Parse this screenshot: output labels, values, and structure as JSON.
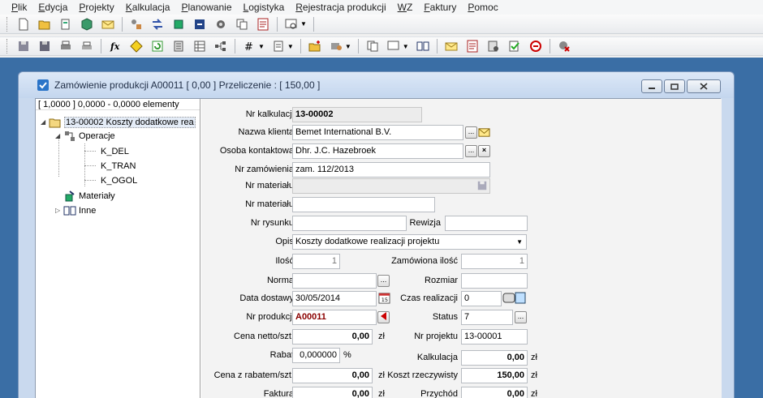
{
  "menu": [
    "Plik",
    "Edycja",
    "Projekty",
    "Kalkulacja",
    "Planowanie",
    "Logistyka",
    "Rejestracja produkcji",
    "WZ",
    "Faktury",
    "Pomoc"
  ],
  "window": {
    "title": "Zamówienie produkcji A00011 [ 0,00 ] Przeliczenie : [ 150,00 ]"
  },
  "tree": {
    "header": "[ 1,0000 ] 0,0000 - 0,0000 elementy",
    "root": "13-00002 Koszty dodatkowe rea",
    "operacje": "Operacje",
    "ops": [
      "K_DEL",
      "K_TRAN",
      "K_OGOL"
    ],
    "materialy": "Materiały",
    "inne": "Inne"
  },
  "form": {
    "nr_kalkulacji": {
      "label": "Nr kalkulacji",
      "value": "13-00002"
    },
    "nazwa_klienta": {
      "label": "Nazwa klienta",
      "value": "Bemet International B.V."
    },
    "osoba_kontaktowa": {
      "label": "Osoba kontaktowa",
      "value": "Dhr. J.C. Hazebroek"
    },
    "nr_zamowienia": {
      "label": "Nr zamówienia",
      "value": "zam. 112/2013"
    },
    "nr_materialu1": {
      "label": "Nr materiału",
      "value": ""
    },
    "nr_materialu2": {
      "label": "Nr materiału",
      "value": ""
    },
    "nr_rysunku": {
      "label": "Nr rysunku",
      "value": ""
    },
    "rewizja": {
      "label": "Rewizja",
      "value": ""
    },
    "opis": {
      "label": "Opis",
      "value": "Koszty dodatkowe realizacji projektu"
    },
    "ilosc": {
      "label": "Ilość",
      "value": "1"
    },
    "zamowiona_ilosc": {
      "label": "Zamówiona ilość",
      "value": "1"
    },
    "norma": {
      "label": "Norma",
      "value": ""
    },
    "rozmiar": {
      "label": "Rozmiar",
      "value": ""
    },
    "data_dostawy": {
      "label": "Data dostawy",
      "value": "30/05/2014"
    },
    "czas_realizacji": {
      "label": "Czas realizacji",
      "value": "0"
    },
    "nr_produkcji": {
      "label": "Nr produkcji",
      "value": "A00011"
    },
    "status": {
      "label": "Status",
      "value": "7"
    },
    "cena_netto": {
      "label": "Cena netto/szt.",
      "value": "0,00",
      "unit": "zł"
    },
    "nr_projektu": {
      "label": "Nr projektu",
      "value": "13-00001"
    },
    "rabat": {
      "label": "Rabat",
      "value": "0,000000",
      "unit": "%"
    },
    "kalkulacja": {
      "label": "Kalkulacja",
      "value": "0,00",
      "unit": "zł"
    },
    "cena_z_rabatem": {
      "label": "Cena z rabatem/szt.",
      "value": "0,00",
      "unit": "zł"
    },
    "koszt_rzeczywisty": {
      "label": "Koszt rzeczywisty",
      "value": "150,00",
      "unit": "zł"
    },
    "faktura": {
      "label": "Faktura",
      "value": "0,00",
      "unit": "zł"
    },
    "przychod": {
      "label": "Przychód",
      "value": "0,00",
      "unit": "zł"
    }
  },
  "buttons": {
    "ellipsis": "...",
    "close_x": "×"
  },
  "colors": {
    "mdi_bg": "#3a6ea5",
    "accent_red": "#8b0000"
  }
}
